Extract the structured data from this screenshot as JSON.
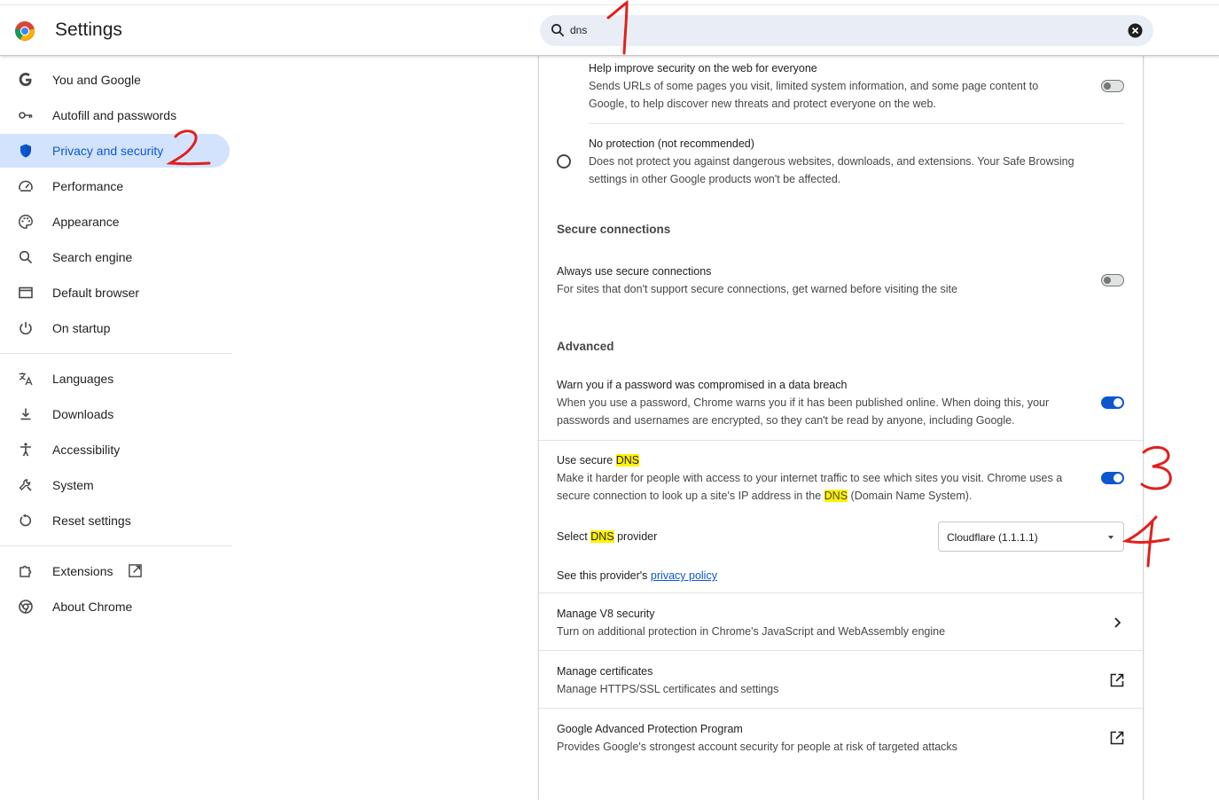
{
  "header": {
    "title": "Settings",
    "search": {
      "value": "dns",
      "placeholder": "Search settings"
    }
  },
  "sidebar": {
    "items": [
      {
        "label": "You and Google",
        "icon": "google-g-icon"
      },
      {
        "label": "Autofill and passwords",
        "icon": "key-icon"
      },
      {
        "label": "Privacy and security",
        "icon": "shield-icon",
        "active": true
      },
      {
        "label": "Performance",
        "icon": "speedometer-icon"
      },
      {
        "label": "Appearance",
        "icon": "palette-icon"
      },
      {
        "label": "Search engine",
        "icon": "search-icon"
      },
      {
        "label": "Default browser",
        "icon": "browser-window-icon"
      },
      {
        "label": "On startup",
        "icon": "power-icon"
      },
      {
        "label": "Languages",
        "icon": "translate-icon"
      },
      {
        "label": "Downloads",
        "icon": "download-icon"
      },
      {
        "label": "Accessibility",
        "icon": "accessibility-icon"
      },
      {
        "label": "System",
        "icon": "wrench-icon"
      },
      {
        "label": "Reset settings",
        "icon": "reset-icon"
      },
      {
        "label": "Extensions",
        "icon": "puzzle-icon"
      },
      {
        "label": "About Chrome",
        "icon": "chrome-icon"
      }
    ]
  },
  "main": {
    "help_improve": {
      "title": "Help improve security on the web for everyone",
      "desc": "Sends URLs of some pages you visit, limited system information, and some page content to Google, to help discover new threats and protect everyone on the web.",
      "enabled": false
    },
    "no_protection": {
      "title": "No protection (not recommended)",
      "desc": "Does not protect you against dangerous websites, downloads, and extensions. Your Safe Browsing settings in other Google products won't be affected."
    },
    "secure_connections": {
      "heading": "Secure connections",
      "always_title": "Always use secure connections",
      "always_desc": "For sites that don't support secure connections, get warned before visiting the site",
      "enabled": false
    },
    "advanced": {
      "heading": "Advanced",
      "warn_title": "Warn you if a password was compromised in a data breach",
      "warn_desc": "When you use a password, Chrome warns you if it has been published online. When doing this, your passwords and usernames are encrypted, so they can't be read by anyone, including Google.",
      "warn_enabled": true,
      "dns_title_prefix": "Use secure ",
      "dns_highlight": "DNS",
      "dns_desc_pre": "Make it harder for people with access to your internet traffic to see which sites you visit. Chrome uses a secure connection to look up a site's IP address in the ",
      "dns_desc_post": " (Domain Name System).",
      "dns_enabled": true,
      "select_prefix": "Select ",
      "select_suffix": " provider",
      "provider_value": "Cloudflare (1.1.1.1)",
      "policy_prefix": "See this provider's ",
      "policy_link": "privacy policy",
      "v8_title": "Manage V8 security",
      "v8_desc": "Turn on additional protection in Chrome's JavaScript and WebAssembly engine",
      "certs_title": "Manage certificates",
      "certs_desc": "Manage HTTPS/SSL certificates and settings",
      "gapp_title": "Google Advanced Protection Program",
      "gapp_desc": "Provides Google's strongest account security for people at risk of targeted attacks"
    }
  },
  "colors": {
    "accent": "#0b57d0",
    "active_bg": "#d3e3fd",
    "highlight": "#fff200",
    "annotation": "#e0201c"
  }
}
